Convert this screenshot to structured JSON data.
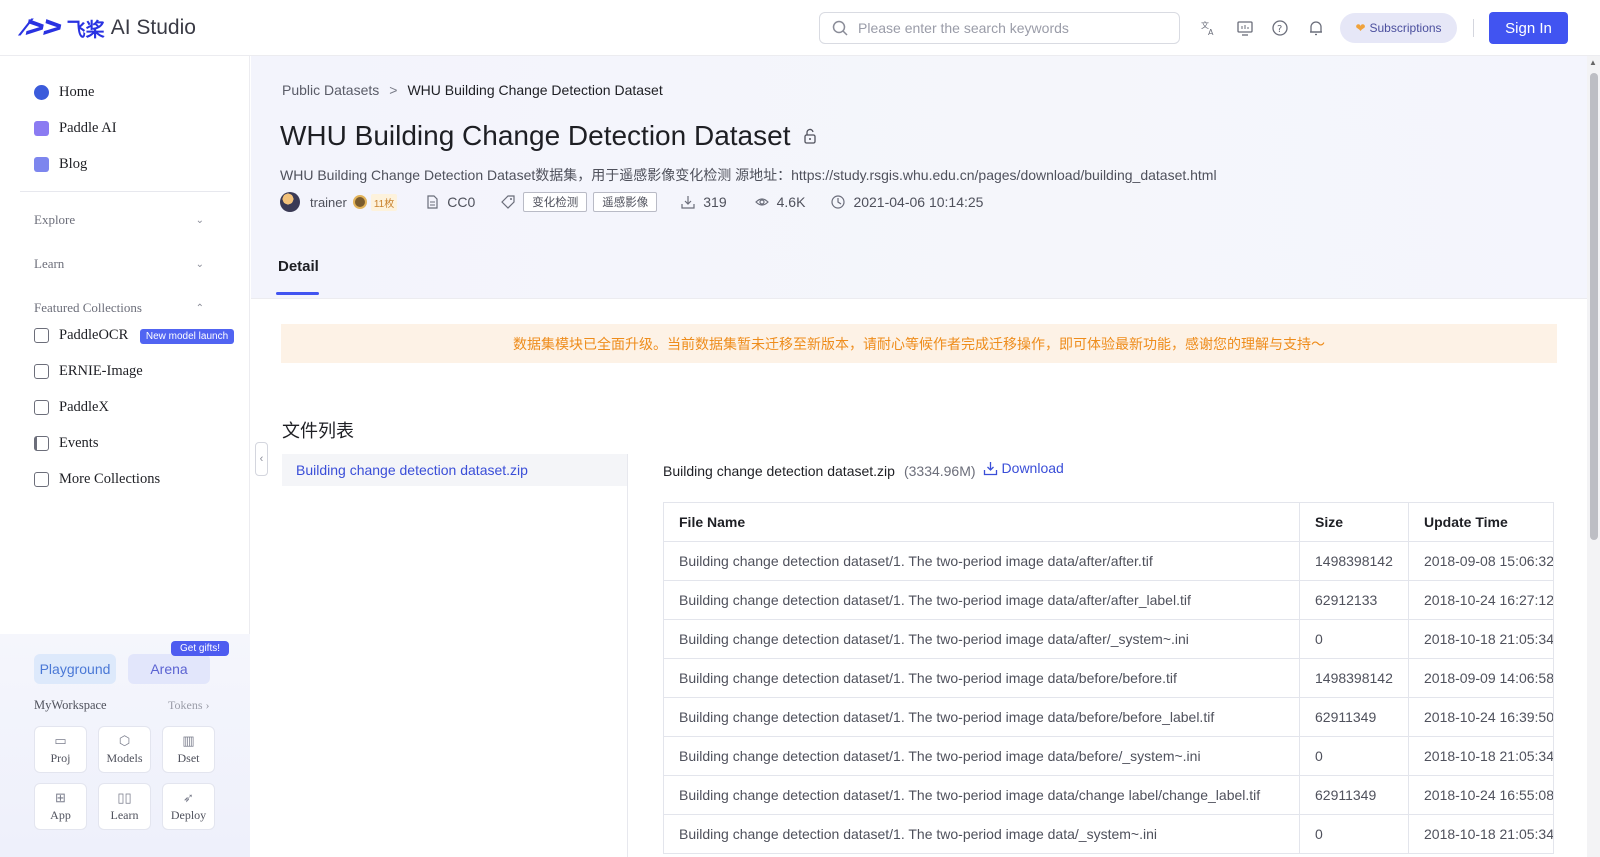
{
  "header": {
    "logo_mark": "⁄ᐳᐳ",
    "logo_cn": "飞桨",
    "logo_text": "AI Studio",
    "search_placeholder": "Please enter the search keywords",
    "subscriptions_label": "Subscriptions",
    "signin_label": "Sign In",
    "icons": [
      "translate-icon",
      "monitor-icon",
      "help-icon",
      "bell-icon"
    ]
  },
  "sidebar": {
    "items": [
      {
        "label": "Home",
        "color": "#3b5bdb"
      },
      {
        "label": "Paddle AI",
        "color": "#7b6cf0"
      },
      {
        "label": "Blog",
        "color": "#6e78e8"
      }
    ],
    "sections": [
      {
        "label": "Explore",
        "chevron": "⌄"
      },
      {
        "label": "Learn",
        "chevron": "⌄"
      },
      {
        "label": "Featured Collections",
        "chevron": "⌃"
      }
    ],
    "collections": [
      {
        "label": "PaddleOCR"
      },
      {
        "label": "ERNIE-Image"
      },
      {
        "label": "PaddleX"
      },
      {
        "label": "Events"
      },
      {
        "label": "More Collections"
      }
    ],
    "new_badge": "New model launch",
    "bottom": {
      "playground": "Playground",
      "arena": "Arena",
      "gift": "Get gifts!",
      "workspace": "MyWorkspace",
      "tokens": "Tokens",
      "buttons": [
        {
          "label": "Proj",
          "glyph": "▭"
        },
        {
          "label": "Models",
          "glyph": "⬡"
        },
        {
          "label": "Dset",
          "glyph": "▥"
        },
        {
          "label": "App",
          "glyph": "⊞"
        },
        {
          "label": "Learn",
          "glyph": "▯▯"
        },
        {
          "label": "Deploy",
          "glyph": "➶"
        }
      ]
    }
  },
  "main": {
    "breadcrumb": {
      "parent": "Public Datasets",
      "sep": ">",
      "current": "WHU Building Change Detection Dataset"
    },
    "title": "WHU Building Change Detection Dataset",
    "description": "WHU Building Change Detection Dataset数据集，用于遥感影像变化检测 源地址：https://study.rsgis.whu.edu.cn/pages/download/building_dataset.html",
    "meta": {
      "user": "trainer",
      "coins": "11枚",
      "license": "CC0",
      "tags": [
        "变化检测",
        "遥感影像"
      ],
      "downloads": "319",
      "views": "4.6K",
      "date": "2021-04-06 10:14:25"
    },
    "tab_label": "Detail",
    "notice": "数据集模块已全面升级。当前数据集暂未迁移至新版本，请耐心等候作者完成迁移操作，即可体验最新功能，感谢您的理解与支持～",
    "files_title": "文件列表",
    "file_list": [
      "Building change detection dataset.zip"
    ],
    "detail": {
      "file_name": "Building change detection dataset.zip",
      "file_size": "(3334.96M)",
      "download_label": "Download"
    },
    "table": {
      "headers": [
        "File Name",
        "Size",
        "Update Time"
      ],
      "rows": [
        [
          "Building change detection dataset/1. The two-period image data/after/after.tif",
          "1498398142",
          "2018-09-08 15:06:32"
        ],
        [
          "Building change detection dataset/1. The two-period image data/after/after_label.tif",
          "62912133",
          "2018-10-24 16:27:12"
        ],
        [
          "Building change detection dataset/1. The two-period image data/after/_system~.ini",
          "0",
          "2018-10-18 21:05:34"
        ],
        [
          "Building change detection dataset/1. The two-period image data/before/before.tif",
          "1498398142",
          "2018-09-09 14:06:58"
        ],
        [
          "Building change detection dataset/1. The two-period image data/before/before_label.tif",
          "62911349",
          "2018-10-24 16:39:50"
        ],
        [
          "Building change detection dataset/1. The two-period image data/before/_system~.ini",
          "0",
          "2018-10-18 21:05:34"
        ],
        [
          "Building change detection dataset/1. The two-period image data/change label/change_label.tif",
          "62911349",
          "2018-10-24 16:55:08"
        ],
        [
          "Building change detection dataset/1. The two-period image data/_system~.ini",
          "0",
          "2018-10-18 21:05:34"
        ]
      ]
    }
  },
  "colors": {
    "accent": "#4154f1",
    "notice_bg": "#fdf2e6",
    "notice_text": "#ee8c1b"
  }
}
